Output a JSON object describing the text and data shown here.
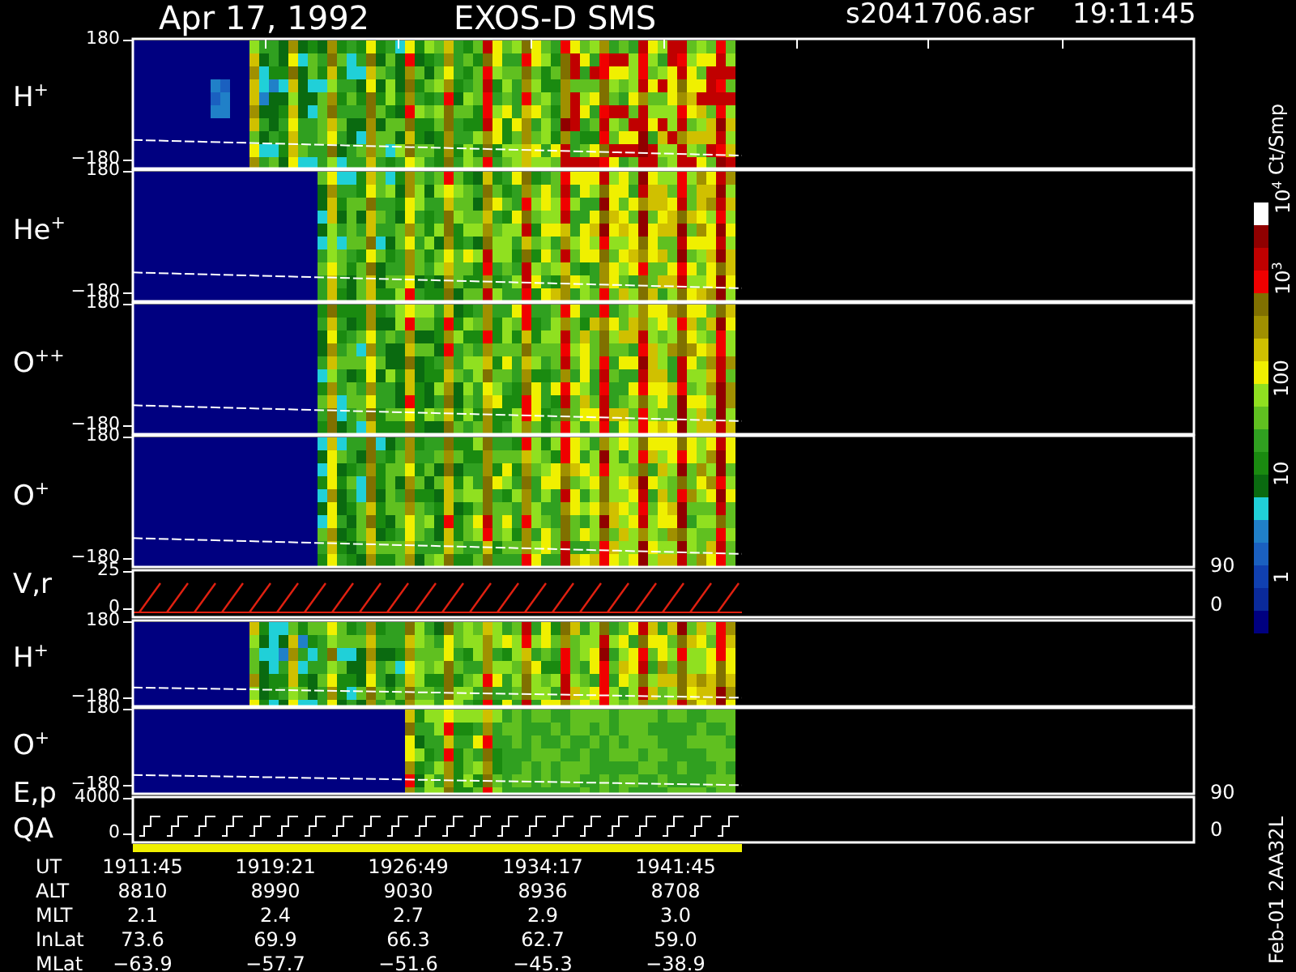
{
  "header": {
    "date": "Apr 17, 1992",
    "instrument": "EXOS-D SMS",
    "file": "s2041706.asr",
    "time": "19:11:45"
  },
  "panels": [
    {
      "kind": "spectrogram",
      "label": "H$^{+}$",
      "ticks": [
        "180",
        "−180"
      ]
    },
    {
      "kind": "spectrogram",
      "label": "He$^{+}$",
      "ticks": [
        "180",
        "−180"
      ]
    },
    {
      "kind": "spectrogram",
      "label": "O$^{++}$",
      "ticks": [
        "180",
        "−180"
      ]
    },
    {
      "kind": "spectrogram",
      "label": "O$^{+}$",
      "ticks": [
        "180",
        "−180"
      ]
    },
    {
      "kind": "velocity",
      "label": "V,r",
      "ticks": [
        "25",
        "0"
      ],
      "right_ticks": [
        "90",
        "0"
      ]
    },
    {
      "kind": "spectrogram",
      "label": "H$^{+}$",
      "ticks": [
        "180",
        "−180"
      ]
    },
    {
      "kind": "spectrogram",
      "label": "O$^{+}$",
      "ticks": [
        "180",
        "−180"
      ]
    },
    {
      "kind": "energy",
      "label": "E,p",
      "label_2": "QA",
      "ticks": [
        "4000",
        "0"
      ],
      "right_ticks": [
        "90",
        "0"
      ]
    }
  ],
  "table": [
    {
      "label": "UT",
      "values": [
        "1911:45",
        "1919:21",
        "1926:49",
        "1934:17",
        "1941:45"
      ]
    },
    {
      "label": "ALT",
      "values": [
        "8810",
        "8990",
        "9030",
        "8936",
        "8708"
      ]
    },
    {
      "label": "MLT",
      "values": [
        "2.1",
        "2.4",
        "2.7",
        "2.9",
        "3.0"
      ]
    },
    {
      "label": "InLat",
      "values": [
        "73.6",
        "69.9",
        "66.3",
        "62.7",
        "59.0"
      ]
    },
    {
      "label": "MLat",
      "values": [
        "−63.9",
        "−57.7",
        "−51.6",
        "−45.3",
        "−38.9"
      ]
    }
  ],
  "colorbar": {
    "unit": "Ct/Smp",
    "labels": [
      "10$^{4}$",
      "10$^{3}$",
      "100",
      "10",
      "1"
    ]
  },
  "footer": "Feb-01 2AA32L"
}
